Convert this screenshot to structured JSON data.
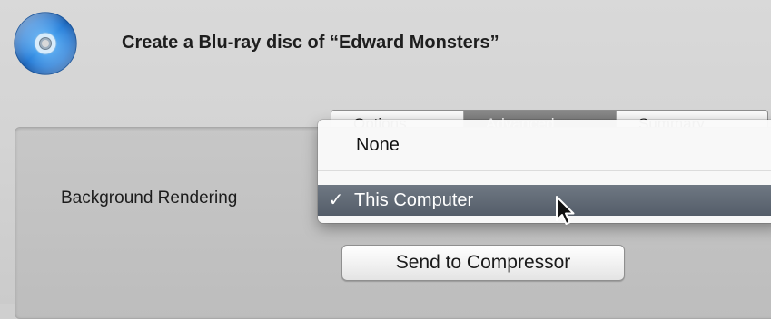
{
  "dialog": {
    "title": "Create a Blu-ray disc of “Edward Monsters”",
    "icon": "blu-ray-disc-icon"
  },
  "tabs": [
    "Options",
    "Advanced",
    "Summary"
  ],
  "background_rendering": {
    "label": "Background Rendering",
    "menu_options": [
      {
        "label": "None",
        "selected": false
      },
      {
        "label": "This Computer",
        "selected": true
      }
    ],
    "checkmark": "✓"
  },
  "buttons": {
    "send_to_compressor": "Send to Compressor"
  },
  "colors": {
    "menu_highlight": "#5f6875",
    "disc_blue": "#2a7fd8"
  }
}
